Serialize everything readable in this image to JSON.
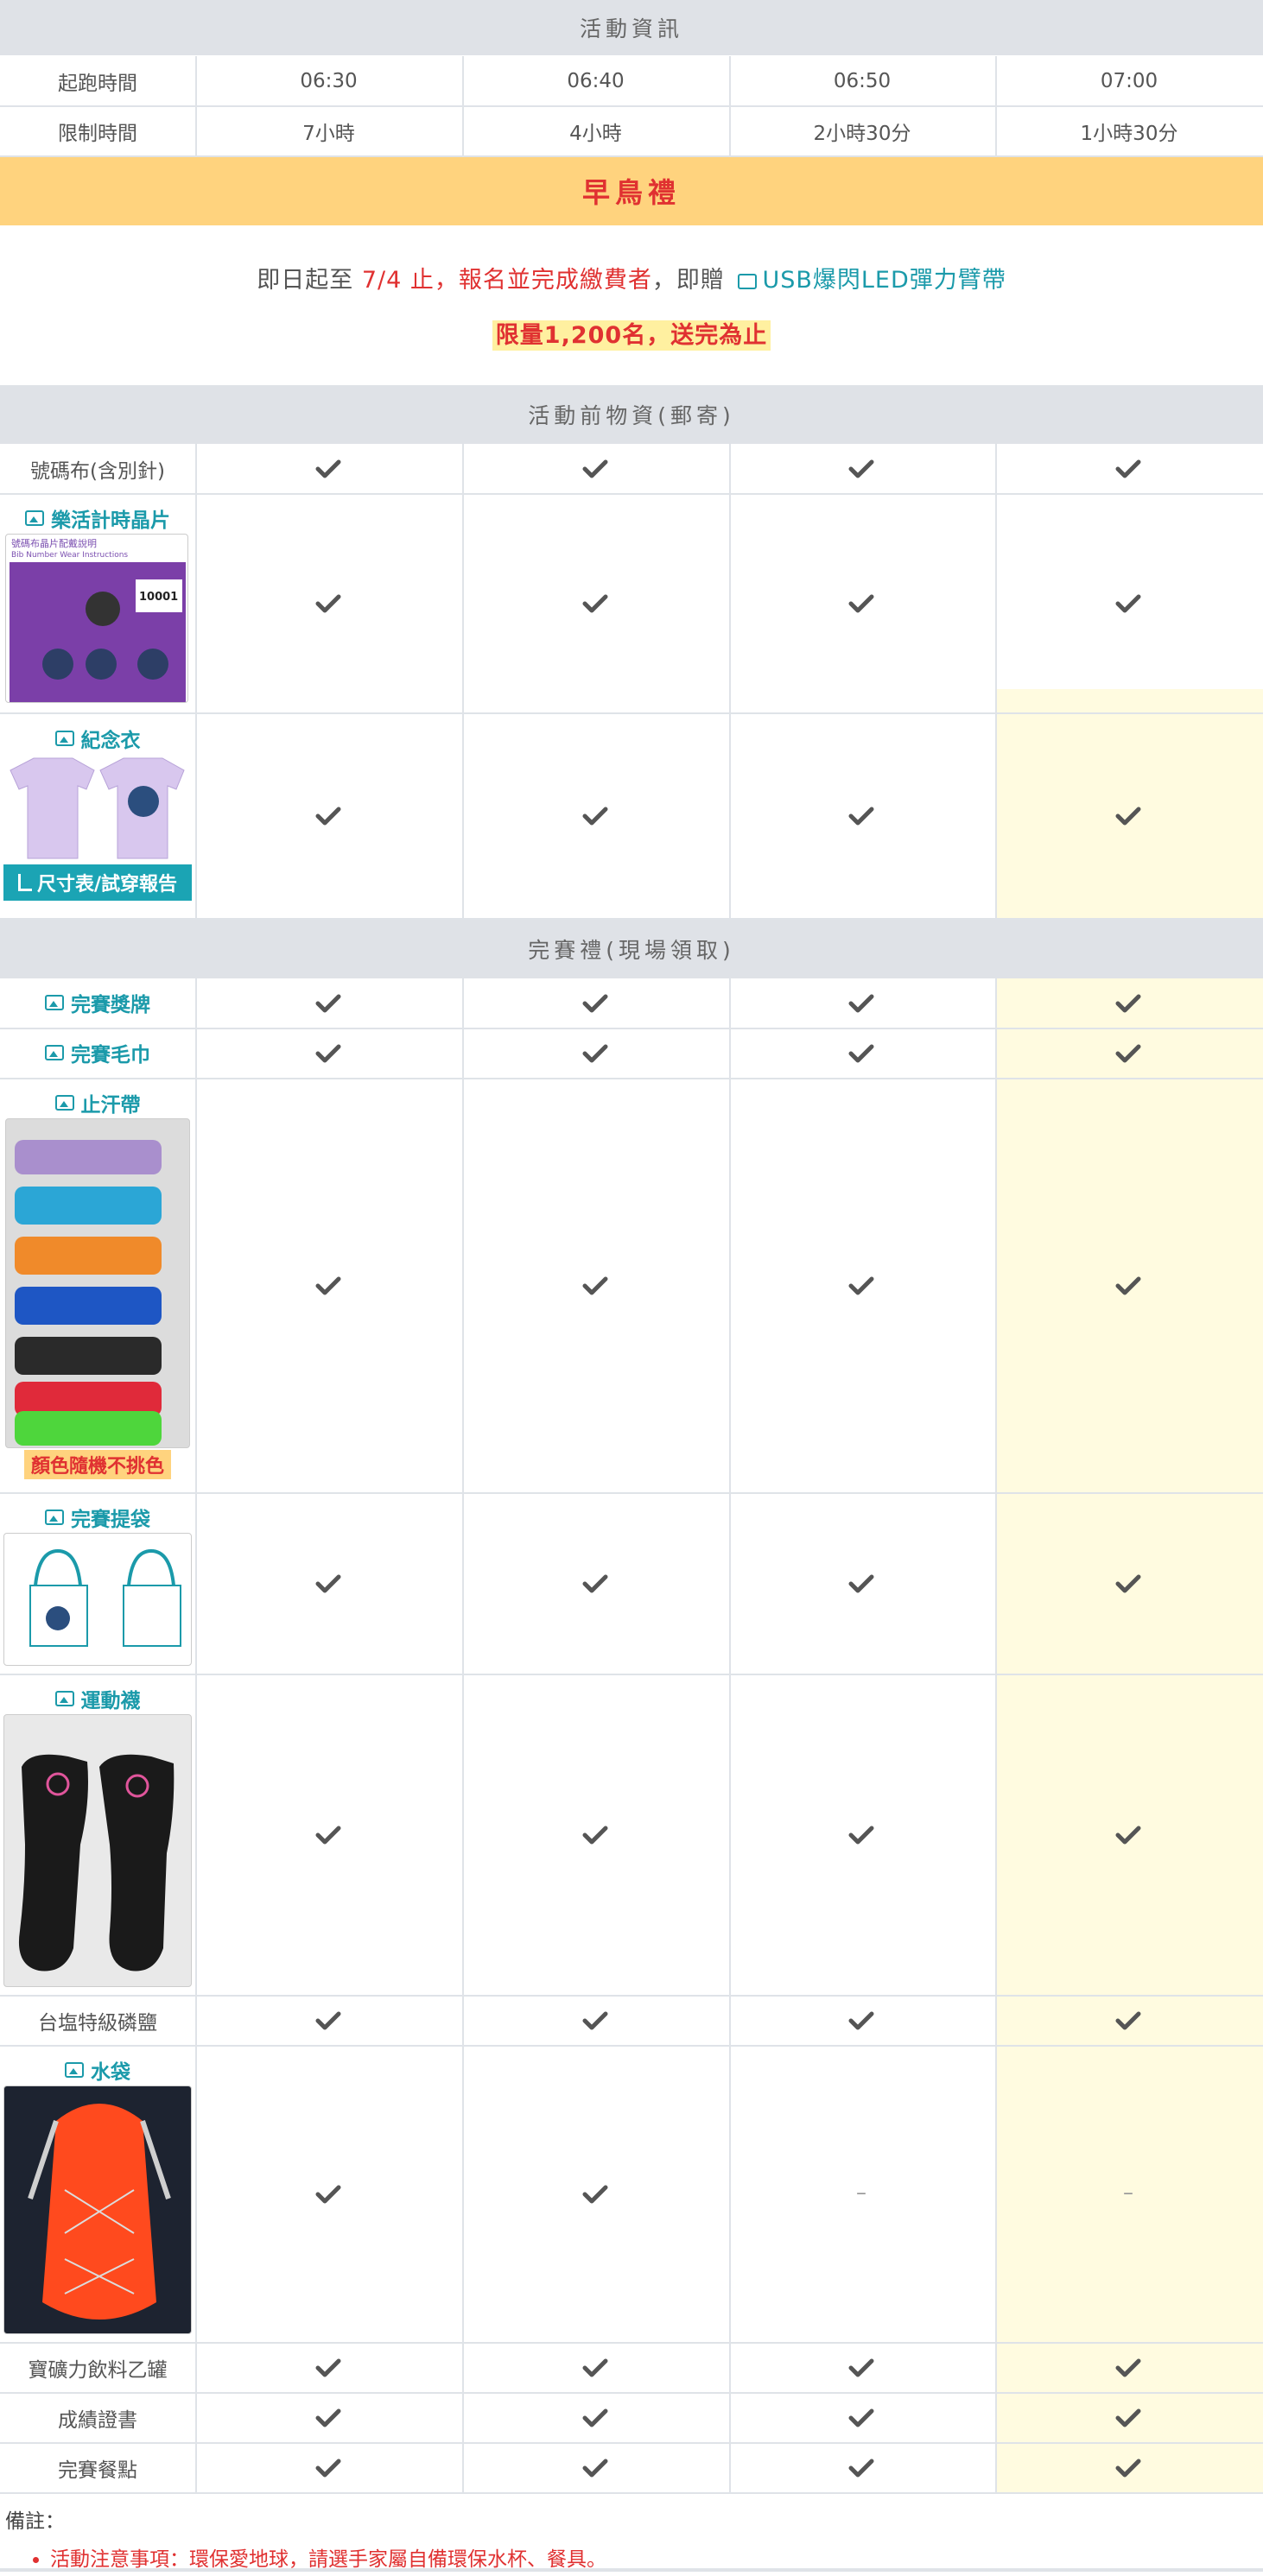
{
  "info_header": "活動資訊",
  "start_time": {
    "label": "起跑時間",
    "values": [
      "06:30",
      "06:40",
      "06:50",
      "07:00"
    ]
  },
  "time_limit": {
    "label": "限制時間",
    "values": [
      "7小時",
      "4小時",
      "2小時30分",
      "1小時30分"
    ]
  },
  "early_bird": {
    "title": "早鳥禮",
    "text_1": "即日起至",
    "deadline": "7/4 止",
    "text_2": "，報名並完成繳費者",
    "text_3": "，即贈",
    "gift": "USB爆閃LED彈力臂帶",
    "limit": "限量1,200名，送完為止"
  },
  "pre_header": "活動前物資(郵寄)",
  "pre_items": {
    "bib": {
      "label": "號碼布(含別針)"
    },
    "chip": {
      "label": "樂活計時晶片",
      "image_title": "號碼布晶片配戴說明",
      "image_sub": "Bib Number Wear Instructions",
      "bib_no": "10001"
    },
    "shirt": {
      "label": "紀念衣",
      "size_button": "尺寸表/試穿報告"
    }
  },
  "finish_header": "完賽禮(現場領取)",
  "finish_items": {
    "medal": {
      "label": "完賽獎牌"
    },
    "towel": {
      "label": "完賽毛巾"
    },
    "sweatband": {
      "label": "止汗帶",
      "note": "顏色隨機不挑色"
    },
    "bag": {
      "label": "完賽提袋"
    },
    "socks": {
      "label": "運動襪"
    },
    "salt": {
      "label": "台塩特級磷鹽"
    },
    "waterbag": {
      "label": "水袋"
    },
    "drink": {
      "label": "寶礦力飲料乙罐"
    },
    "cert": {
      "label": "成績證書"
    },
    "meal": {
      "label": "完賽餐點"
    }
  },
  "dash_symbol": "–",
  "notes": {
    "title": "備註：",
    "items": [
      "活動注意事項：環保愛地球，請選手家屬自備環保水杯、餐具。"
    ]
  },
  "colors": {
    "accent": "#1b9aaa",
    "red": "#e03131",
    "highlight": "#fffbe0",
    "early_bird_bg": "#ffd37e"
  }
}
